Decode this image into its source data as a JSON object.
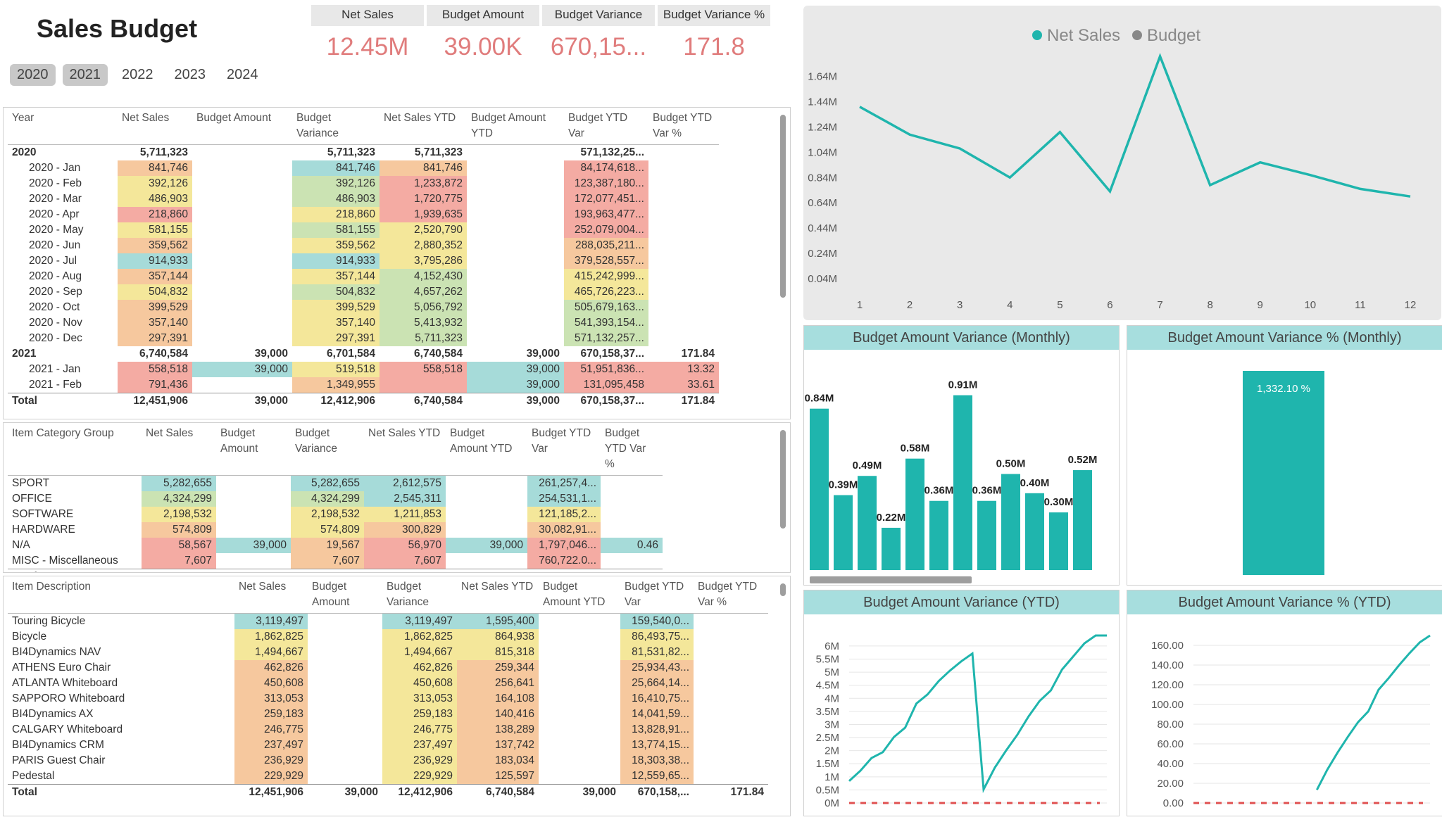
{
  "header": {
    "title": "Sales Budget"
  },
  "years": [
    {
      "label": "2020",
      "selected": true
    },
    {
      "label": "2021",
      "selected": true
    },
    {
      "label": "2022",
      "selected": false
    },
    {
      "label": "2023",
      "selected": false
    },
    {
      "label": "2024",
      "selected": false
    }
  ],
  "kpis": [
    {
      "label": "Net Sales",
      "value": "12.45M"
    },
    {
      "label": "Budget Amount",
      "value": "39.00K"
    },
    {
      "label": "Budget Variance",
      "value": "670,15..."
    },
    {
      "label": "Budget Variance %",
      "value": "171.8"
    }
  ],
  "table1": {
    "headers": [
      "Year",
      "Net Sales",
      "Budget Amount",
      "Budget Variance",
      "Net Sales YTD",
      "Budget Amount YTD",
      "Budget YTD Var",
      "Budget YTD Var %"
    ],
    "rows": [
      {
        "kind": "bold",
        "cells": [
          "2020",
          "5,711,323",
          "",
          "5,711,323",
          "5,711,323",
          "",
          "571,132,25...",
          ""
        ]
      },
      {
        "kind": "child",
        "cells": [
          "2020 - Jan",
          "841,746",
          "",
          "841,746",
          "841,746",
          "",
          "84,174,618...",
          ""
        ]
      },
      {
        "kind": "child",
        "cells": [
          "2020 - Feb",
          "392,126",
          "",
          "392,126",
          "1,233,872",
          "",
          "123,387,180...",
          ""
        ]
      },
      {
        "kind": "child",
        "cells": [
          "2020 - Mar",
          "486,903",
          "",
          "486,903",
          "1,720,775",
          "",
          "172,077,451...",
          ""
        ]
      },
      {
        "kind": "child",
        "cells": [
          "2020 - Apr",
          "218,860",
          "",
          "218,860",
          "1,939,635",
          "",
          "193,963,477...",
          ""
        ]
      },
      {
        "kind": "child",
        "cells": [
          "2020 - May",
          "581,155",
          "",
          "581,155",
          "2,520,790",
          "",
          "252,079,004...",
          ""
        ]
      },
      {
        "kind": "child",
        "cells": [
          "2020 - Jun",
          "359,562",
          "",
          "359,562",
          "2,880,352",
          "",
          "288,035,211...",
          ""
        ]
      },
      {
        "kind": "child",
        "cells": [
          "2020 - Jul",
          "914,933",
          "",
          "914,933",
          "3,795,286",
          "",
          "379,528,557...",
          ""
        ]
      },
      {
        "kind": "child",
        "cells": [
          "2020 - Aug",
          "357,144",
          "",
          "357,144",
          "4,152,430",
          "",
          "415,242,999...",
          ""
        ]
      },
      {
        "kind": "child",
        "cells": [
          "2020 - Sep",
          "504,832",
          "",
          "504,832",
          "4,657,262",
          "",
          "465,726,223...",
          ""
        ]
      },
      {
        "kind": "child",
        "cells": [
          "2020 - Oct",
          "399,529",
          "",
          "399,529",
          "5,056,792",
          "",
          "505,679,163...",
          ""
        ]
      },
      {
        "kind": "child",
        "cells": [
          "2020 - Nov",
          "357,140",
          "",
          "357,140",
          "5,413,932",
          "",
          "541,393,154...",
          ""
        ]
      },
      {
        "kind": "child",
        "cells": [
          "2020 - Dec",
          "297,391",
          "",
          "297,391",
          "5,711,323",
          "",
          "571,132,257...",
          ""
        ]
      },
      {
        "kind": "bold",
        "cells": [
          "2021",
          "6,740,584",
          "39,000",
          "6,701,584",
          "6,740,584",
          "39,000",
          "670,158,37...",
          "171.84"
        ]
      },
      {
        "kind": "child",
        "cells": [
          "2021 - Jan",
          "558,518",
          "39,000",
          "519,518",
          "558,518",
          "39,000",
          "51,951,836...",
          "13.32"
        ]
      },
      {
        "kind": "child",
        "cells": [
          "2021 - Feb",
          "791,436",
          "",
          "1,349,955",
          "",
          "39,000",
          "131,095,458",
          "33.61"
        ]
      }
    ],
    "total": [
      "Total",
      "12,451,906",
      "39,000",
      "12,412,906",
      "6,740,584",
      "39,000",
      "670,158,37...",
      "171.84"
    ]
  },
  "table2": {
    "headers": [
      "Item Category Group",
      "Net Sales",
      "Budget Amount",
      "Budget Variance",
      "Net Sales YTD",
      "Budget Amount YTD",
      "Budget YTD Var",
      "Budget YTD Var %"
    ],
    "rows": [
      [
        "SPORT",
        "5,282,655",
        "",
        "5,282,655",
        "2,612,575",
        "",
        "261,257,4...",
        ""
      ],
      [
        "OFFICE",
        "4,324,299",
        "",
        "4,324,299",
        "2,545,311",
        "",
        "254,531,1...",
        ""
      ],
      [
        "SOFTWARE",
        "2,198,532",
        "",
        "2,198,532",
        "1,211,853",
        "",
        "121,185,2...",
        ""
      ],
      [
        "HARDWARE",
        "574,809",
        "",
        "574,809",
        "300,829",
        "",
        "30,082,91...",
        ""
      ],
      [
        "N/A",
        "58,567",
        "39,000",
        "19,567",
        "56,970",
        "39,000",
        "1,797,046...",
        "0.46"
      ],
      [
        "MISC - Miscellaneous",
        "7,607",
        "",
        "7,607",
        "7,607",
        "",
        "760,722.0...",
        ""
      ]
    ],
    "total": [
      "Total",
      "12,451,906",
      "39,000",
      "12,412,906",
      "6,740,584",
      "39,000",
      "670,158,...",
      "171.84"
    ]
  },
  "table3": {
    "headers": [
      "Item Description",
      "Net Sales",
      "Budget Amount",
      "Budget Variance",
      "Net Sales YTD",
      "Budget Amount YTD",
      "Budget YTD Var",
      "Budget YTD Var %"
    ],
    "rows": [
      [
        "Touring Bicycle",
        "3,119,497",
        "",
        "3,119,497",
        "1,595,400",
        "",
        "159,540,0...",
        ""
      ],
      [
        "Bicycle",
        "1,862,825",
        "",
        "1,862,825",
        "864,938",
        "",
        "86,493,75...",
        ""
      ],
      [
        "BI4Dynamics NAV",
        "1,494,667",
        "",
        "1,494,667",
        "815,318",
        "",
        "81,531,82...",
        ""
      ],
      [
        "ATHENS Euro Chair",
        "462,826",
        "",
        "462,826",
        "259,344",
        "",
        "25,934,43...",
        ""
      ],
      [
        "ATLANTA Whiteboard",
        "450,608",
        "",
        "450,608",
        "256,641",
        "",
        "25,664,14...",
        ""
      ],
      [
        "SAPPORO Whiteboard",
        "313,053",
        "",
        "313,053",
        "164,108",
        "",
        "16,410,75...",
        ""
      ],
      [
        "BI4Dynamics AX",
        "259,183",
        "",
        "259,183",
        "140,416",
        "",
        "14,041,59...",
        ""
      ],
      [
        "CALGARY Whiteboard",
        "246,775",
        "",
        "246,775",
        "138,289",
        "",
        "13,828,91...",
        ""
      ],
      [
        "BI4Dynamics CRM",
        "237,497",
        "",
        "237,497",
        "137,742",
        "",
        "13,774,15...",
        ""
      ],
      [
        "PARIS Guest Chair",
        "236,929",
        "",
        "236,929",
        "183,034",
        "",
        "18,303,38...",
        ""
      ],
      [
        "Pedestal",
        "229,929",
        "",
        "229,929",
        "125,597",
        "",
        "12,559,65...",
        ""
      ]
    ],
    "total": [
      "Total",
      "12,451,906",
      "39,000",
      "12,412,906",
      "6,740,584",
      "39,000",
      "670,158,...",
      "171.84"
    ]
  },
  "colors": {
    "accent": "#1fb5ad",
    "kpi_value": "#e07c7c",
    "budget_line": "#e05050",
    "title_band": "#a7dede",
    "heat_teal": "#a6dbd9",
    "heat_green": "#cbe3b3",
    "heat_yellow": "#f4e79a",
    "heat_orange": "#f6c89e",
    "heat_red": "#f4aba3"
  },
  "chart_data": [
    {
      "type": "line",
      "legend": [
        "Net Sales",
        "Budget"
      ],
      "legend_position": "top",
      "x": [
        1,
        2,
        3,
        4,
        5,
        6,
        7,
        8,
        9,
        10,
        11,
        12
      ],
      "series": [
        {
          "name": "Net Sales",
          "values": [
            1.4,
            1.18,
            1.07,
            0.84,
            1.2,
            0.73,
            1.8,
            0.78,
            0.96,
            0.86,
            0.75,
            0.69
          ]
        }
      ],
      "yticks": [
        "1.64M",
        "1.44M",
        "1.24M",
        "1.04M",
        "0.84M",
        "0.64M",
        "0.44M",
        "0.24M",
        "0.04M"
      ],
      "ylim": [
        0,
        1.8
      ],
      "grid": false
    },
    {
      "type": "bar",
      "title": "Budget Amount Variance (Monthly)",
      "data_labels": [
        "0.84M",
        "0.39M",
        "0.49M",
        "0.22M",
        "0.58M",
        "0.36M",
        "0.91M",
        "0.36M",
        "0.50M",
        "0.40M",
        "0.30M",
        "0.52M"
      ],
      "values": [
        0.84,
        0.39,
        0.49,
        0.22,
        0.58,
        0.36,
        0.91,
        0.36,
        0.5,
        0.4,
        0.3,
        0.52
      ],
      "ylim": [
        0,
        1.0
      ]
    },
    {
      "type": "bar",
      "title": "Budget Amount Variance % (Monthly)",
      "data_labels": [
        "1,332.10 %"
      ],
      "values": [
        1332.1
      ]
    },
    {
      "type": "line",
      "title": "Budget Amount Variance (YTD)",
      "yticks": [
        "6M",
        "5.5M",
        "5M",
        "4.5M",
        "4M",
        "3.5M",
        "3M",
        "2.5M",
        "2M",
        "1.5M",
        "1M",
        "0.5M",
        "0M"
      ],
      "ylim": [
        0,
        6.4
      ],
      "series": [
        {
          "name": "",
          "values": [
            0.84,
            1.23,
            1.72,
            1.94,
            2.52,
            2.88,
            3.8,
            4.15,
            4.66,
            5.06,
            5.41,
            5.71,
            0.52,
            1.35,
            2.0,
            2.6,
            3.3,
            3.9,
            4.3,
            5.1,
            5.6,
            6.1,
            6.6,
            7.0
          ]
        }
      ],
      "budget_line": 0
    },
    {
      "type": "line",
      "title": "Budget Amount Variance % (YTD)",
      "yticks": [
        "160.00",
        "140.00",
        "120.00",
        "100.00",
        "80.00",
        "60.00",
        "40.00",
        "20.00",
        "0.00"
      ],
      "ylim": [
        0,
        170
      ],
      "series": [
        {
          "name": "",
          "values": [
            null,
            null,
            null,
            null,
            null,
            null,
            null,
            null,
            null,
            null,
            null,
            null,
            13.32,
            33.61,
            51,
            67,
            82,
            93,
            115,
            127,
            140,
            152,
            163,
            172
          ]
        }
      ],
      "budget_line": 0
    }
  ]
}
